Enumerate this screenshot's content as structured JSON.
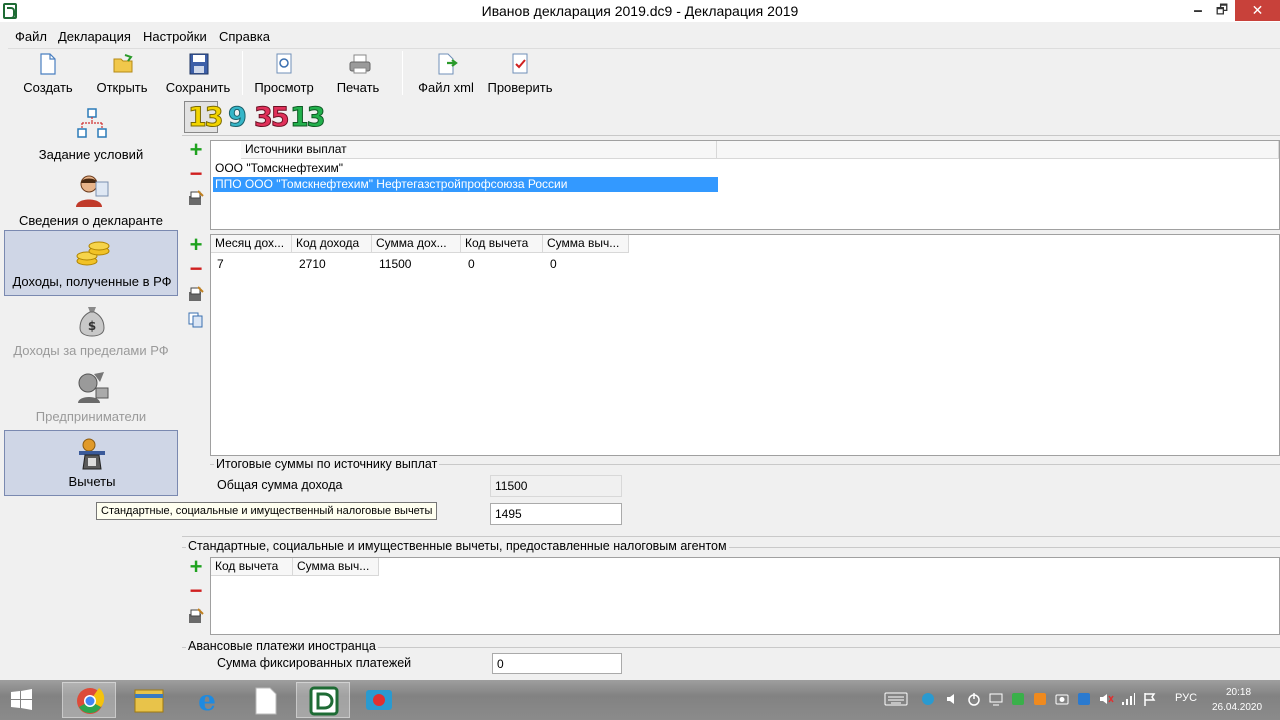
{
  "window": {
    "title": "Иванов декларация 2019.dc9 - Декларация 2019",
    "minimize": "🗕",
    "maximize": "🗗",
    "close": "✕"
  },
  "menu": [
    "Файл",
    "Декларация",
    "Настройки",
    "Справка"
  ],
  "toolbar": {
    "create": "Создать",
    "open": "Открыть",
    "save": "Сохранить",
    "preview": "Просмотр",
    "print": "Печать",
    "xml": "Файл xml",
    "check": "Проверить"
  },
  "nav": [
    {
      "label": "Задание условий",
      "icon": "conditions-tree-icon"
    },
    {
      "label": "Сведения о декларанте",
      "icon": "person-icon"
    },
    {
      "label": "Доходы, полученные в РФ",
      "icon": "coins-icon"
    },
    {
      "label": "Доходы за пределами РФ",
      "icon": "money-bag-icon"
    },
    {
      "label": "Предприниматели",
      "icon": "entrepreneur-icon"
    },
    {
      "label": "Вычеты",
      "icon": "deductions-icon"
    }
  ],
  "rates": [
    "13",
    "9",
    "35",
    "13"
  ],
  "sources": {
    "header": "Источники выплат",
    "rows": [
      "ООО \"Томскнефтехим\"",
      "ППО ООО \"Томскнефтехим\" Нефтегазстройпрофсоюза России"
    ]
  },
  "income": {
    "headers": [
      "Месяц дох...",
      "Код дохода",
      "Сумма дох...",
      "Код вычета",
      "Сумма выч..."
    ],
    "rows": [
      [
        "7",
        "2710",
        "11500",
        "0",
        "0"
      ]
    ]
  },
  "totals": {
    "title": "Итоговые суммы по источнику выплат",
    "income_label": "Общая сумма дохода",
    "income_value": "11500",
    "tax_value": "1495"
  },
  "tooltip": "Стандартные, социальные и имущественный налоговые вычеты",
  "agent_deductions": {
    "title": "Стандартные, социальные и имущественные вычеты, предоставленные налоговым агентом",
    "headers": [
      "Код вычета",
      "Сумма выч..."
    ]
  },
  "advance": {
    "title": "Авансовые платежи иностранца",
    "label": "Сумма фиксированных платежей",
    "value": "0"
  },
  "taskbar": {
    "lang": "РУС",
    "time": "20:18",
    "date": "26.04.2020"
  },
  "colors": {
    "selection": "#3399ff",
    "nav_selected": "#cfd6e6",
    "rate1": "#f2d400",
    "rate2": "#35b6c8",
    "rate3": "#e0305a",
    "rate4": "#22b04c"
  }
}
